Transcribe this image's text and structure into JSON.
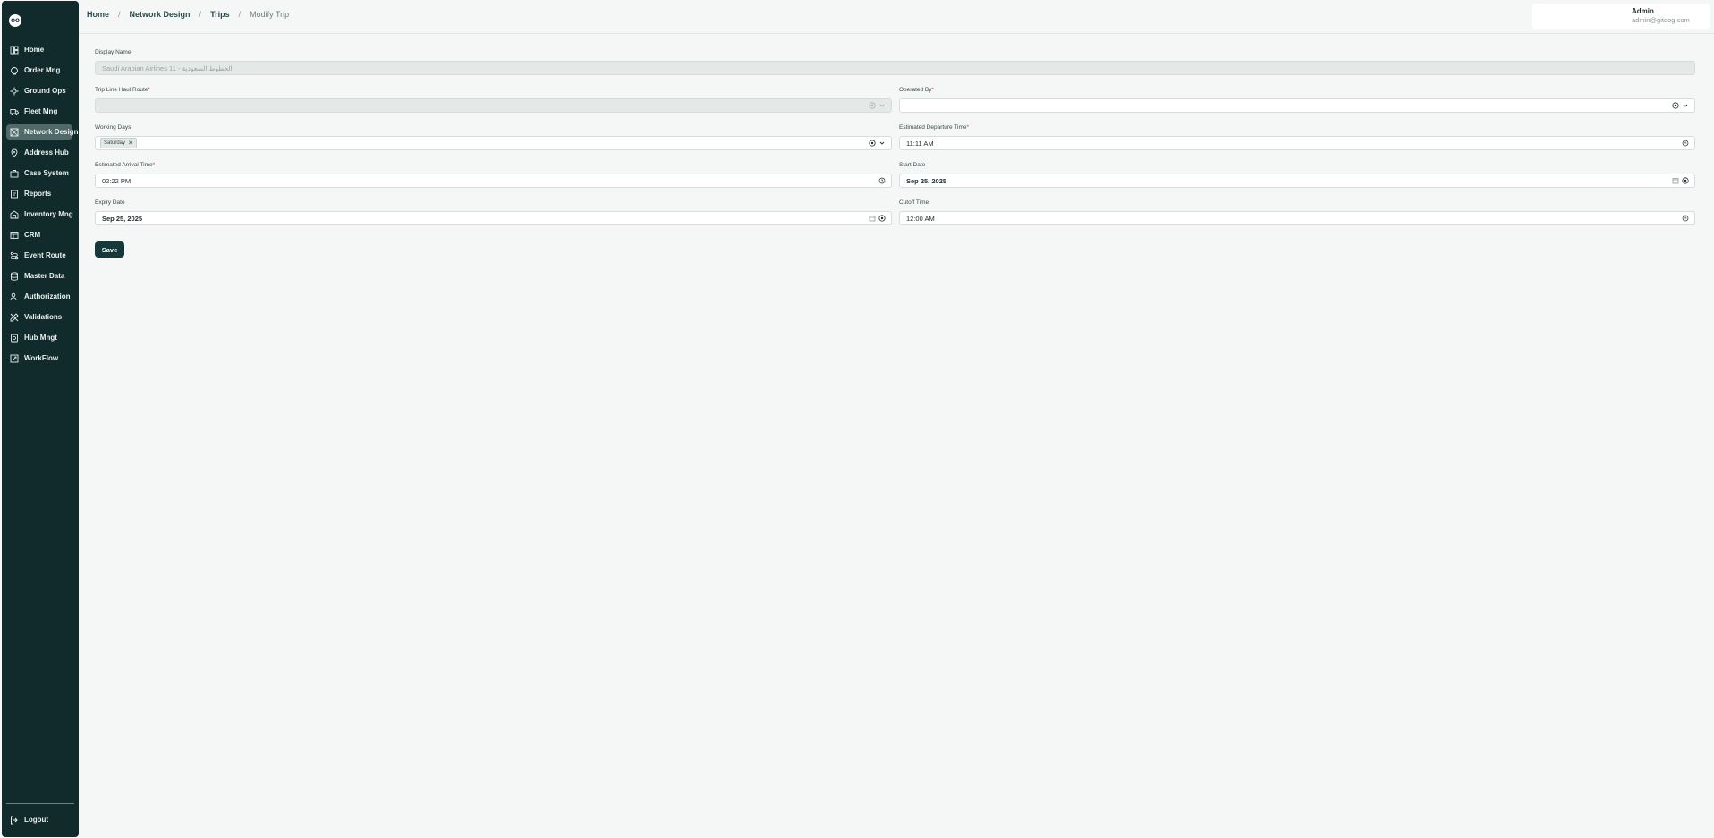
{
  "app": {
    "logo_text": "oo"
  },
  "sidebar": {
    "items": [
      {
        "label": "Home",
        "icon": "dashboard-icon"
      },
      {
        "label": "Order Mng",
        "icon": "order-icon"
      },
      {
        "label": "Ground Ops",
        "icon": "ground-ops-icon"
      },
      {
        "label": "Fleet Mng",
        "icon": "truck-icon"
      },
      {
        "label": "Network Design",
        "icon": "network-icon",
        "active": true
      },
      {
        "label": "Address Hub",
        "icon": "map-pin-icon"
      },
      {
        "label": "Case System",
        "icon": "case-icon"
      },
      {
        "label": "Reports",
        "icon": "report-icon"
      },
      {
        "label": "Inventory Mng",
        "icon": "inventory-icon"
      },
      {
        "label": "CRM",
        "icon": "crm-icon"
      },
      {
        "label": "Event Route",
        "icon": "route-icon"
      },
      {
        "label": "Master Data",
        "icon": "database-icon"
      },
      {
        "label": "Authorization",
        "icon": "users-icon"
      },
      {
        "label": "Validations",
        "icon": "validation-icon"
      },
      {
        "label": "Hub Mngt",
        "icon": "hub-icon"
      },
      {
        "label": "WorkFlow",
        "icon": "workflow-icon"
      }
    ],
    "logout_label": "Logout"
  },
  "breadcrumb": {
    "items": [
      "Home",
      "Network Design",
      "Trips"
    ],
    "current": "Modify Trip",
    "separator": "/"
  },
  "header": {
    "user_name": "Admin",
    "user_email": "admin@gitdog.com"
  },
  "form": {
    "display_name": {
      "label": "Display Name",
      "value": "Saudi Arabian Airlines 11 - الخطوط السعودية"
    },
    "trip_line_haul_route": {
      "label": "Trip Line Haul Route",
      "required": "*",
      "value": ""
    },
    "operated_by": {
      "label": "Operated By",
      "required": "*",
      "value": ""
    },
    "working_days": {
      "label": "Working Days",
      "chips": [
        "Saturday"
      ]
    },
    "estimated_departure_time": {
      "label": "Estimated Departure Time",
      "required": "*",
      "value": "11:11 AM"
    },
    "estimated_arrival_time": {
      "label": "Estimated Arrival Time",
      "required": "*",
      "value": "02:22 PM"
    },
    "start_date": {
      "label": "Start Date",
      "value": "Sep 25, 2025"
    },
    "expiry_date": {
      "label": "Expiry Date",
      "value": "Sep 25, 2025"
    },
    "cutoff_time": {
      "label": "Cutoff Time",
      "value": "12:00 AM"
    },
    "save_label": "Save"
  },
  "colors": {
    "sidebar_bg": "#112b2c",
    "active_item_bg": "#52696a",
    "primary_button": "#15393a",
    "required_mark": "#d14343"
  }
}
